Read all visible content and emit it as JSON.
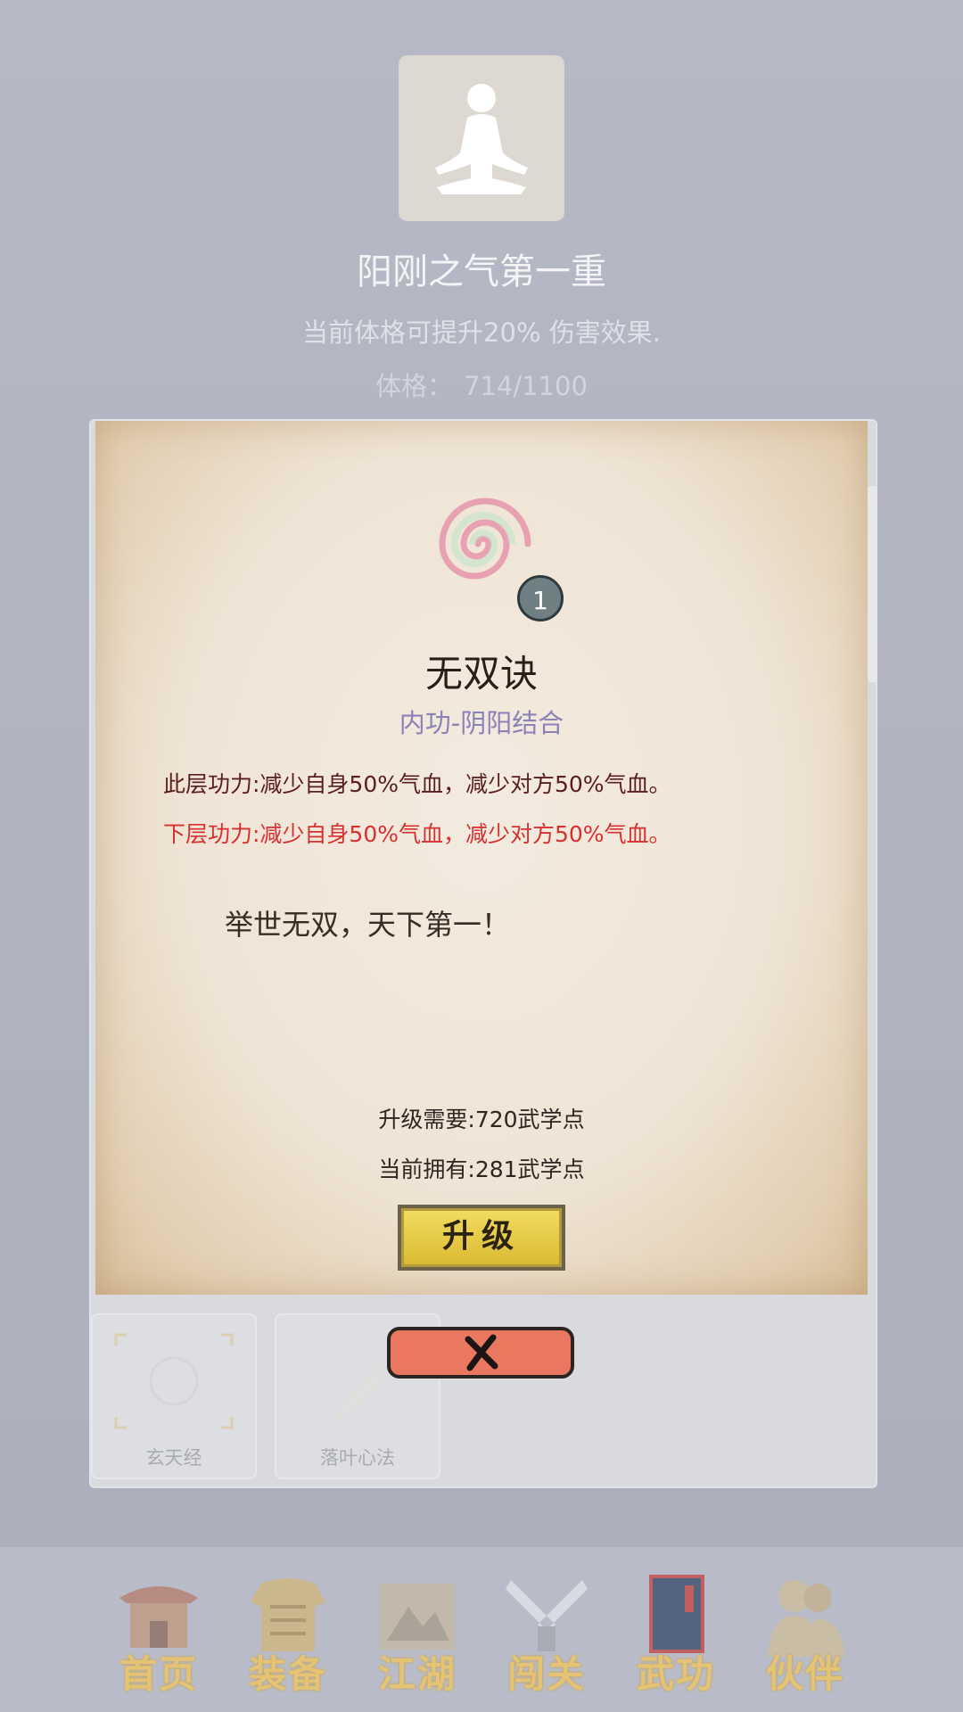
{
  "header": {
    "avatar_icon": "meditation-icon",
    "title": "阳刚之气第一重",
    "description": "当前体格可提升20% 伤害效果.",
    "stat_label": "体格：",
    "stat_value": "714/1100"
  },
  "popup": {
    "level": "1",
    "name": "无双诀",
    "type": "内功-阴阳结合",
    "current_effect": "此层功力:减少自身50%气血，减少对方50%气血。",
    "next_effect": "下层功力:减少自身50%气血，减少对方50%气血。",
    "motto": "举世无双，天下第一！",
    "upgrade_need": "升级需要:720武学点",
    "current_have": "当前拥有:281武学点",
    "upgrade_label": "升级",
    "close_icon": "close-icon"
  },
  "list": {
    "cards": [
      {
        "label": "玄天经"
      },
      {
        "label": "落叶心法"
      }
    ]
  },
  "nav": {
    "items": [
      {
        "label": "首页",
        "icon": "temple-icon"
      },
      {
        "label": "装备",
        "icon": "armor-icon"
      },
      {
        "label": "江湖",
        "icon": "scroll-map-icon"
      },
      {
        "label": "闯关",
        "icon": "crossed-swords-icon"
      },
      {
        "label": "武功",
        "icon": "book-icon"
      },
      {
        "label": "伙伴",
        "icon": "companions-icon"
      }
    ]
  },
  "colors": {
    "accent_red": "#d7312f",
    "type_purple": "#8b82b8",
    "nav_gold": "#e9c46b",
    "upgrade_yellow": "#f3dd63",
    "close_red": "#ea7860"
  }
}
